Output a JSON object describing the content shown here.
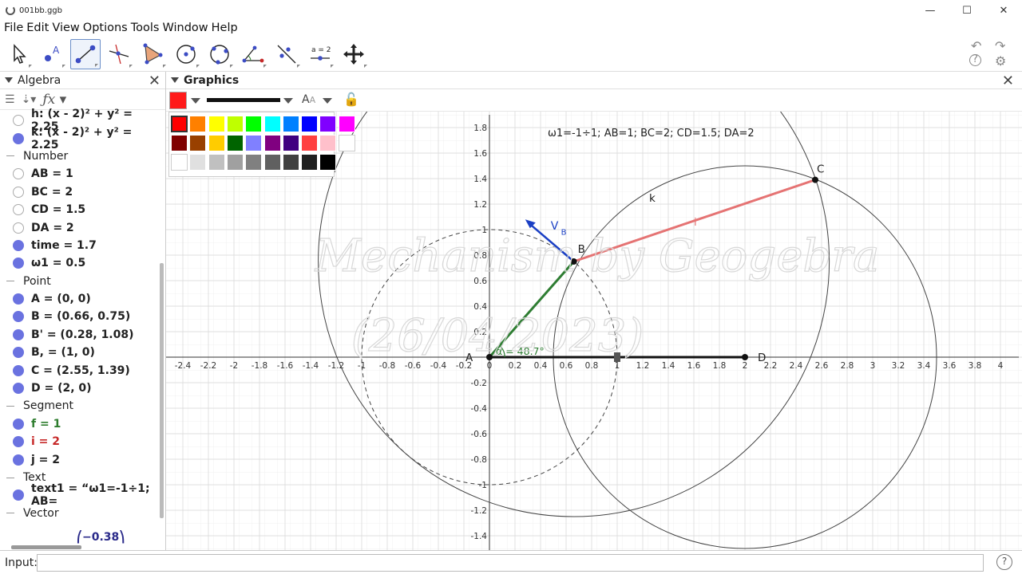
{
  "window": {
    "title": "001bb.ggb",
    "minimize": "—",
    "maximize": "☐",
    "close": "✕"
  },
  "menu": [
    "File",
    "Edit",
    "View",
    "Options",
    "Tools",
    "Window",
    "Help"
  ],
  "toolbar": {
    "tools": [
      "move-tool",
      "point-tool",
      "segment-tool",
      "perpendicular-line-tool",
      "polygon-tool",
      "circle-center-point-tool",
      "circle-three-points-tool",
      "angle-tool",
      "reflect-tool",
      "slider-tool",
      "move-graphics-view-tool"
    ],
    "slider_tool_label": "a = 2",
    "point_tool_label": "A"
  },
  "algebra": {
    "title": "Algebra",
    "items": [
      {
        "type": "item",
        "text": "h: (x - 2)² + y² = 2.25",
        "visible": false,
        "color": "#222222"
      },
      {
        "type": "item",
        "text": "k: (x - 2)² + y² = 2.25",
        "visible": true,
        "color": "#222222"
      },
      {
        "type": "group",
        "text": "Number"
      },
      {
        "type": "item",
        "text": "AB = 1",
        "visible": false,
        "color": "#222222"
      },
      {
        "type": "item",
        "text": "BC = 2",
        "visible": false,
        "color": "#222222"
      },
      {
        "type": "item",
        "text": "CD = 1.5",
        "visible": false,
        "color": "#222222"
      },
      {
        "type": "item",
        "text": "DA = 2",
        "visible": false,
        "color": "#222222"
      },
      {
        "type": "item",
        "text": "time = 1.7",
        "visible": true,
        "color": "#222222"
      },
      {
        "type": "item",
        "text": "ω1 = 0.5",
        "visible": true,
        "color": "#222222"
      },
      {
        "type": "group",
        "text": "Point"
      },
      {
        "type": "item",
        "text": "A = (0, 0)",
        "visible": true,
        "color": "#222222"
      },
      {
        "type": "item",
        "text": "B = (0.66, 0.75)",
        "visible": true,
        "color": "#222222"
      },
      {
        "type": "item",
        "text": "B' = (0.28, 1.08)",
        "visible": true,
        "color": "#222222"
      },
      {
        "type": "item",
        "text": "B, = (1, 0)",
        "visible": true,
        "color": "#222222"
      },
      {
        "type": "item",
        "text": "C = (2.55, 1.39)",
        "visible": true,
        "color": "#222222"
      },
      {
        "type": "item",
        "text": "D = (2, 0)",
        "visible": true,
        "color": "#222222"
      },
      {
        "type": "group",
        "text": "Segment"
      },
      {
        "type": "item",
        "text": "f = 1",
        "visible": true,
        "color": "#2e7d2e"
      },
      {
        "type": "item",
        "text": "i = 2",
        "visible": true,
        "color": "#c62828"
      },
      {
        "type": "item",
        "text": "j = 2",
        "visible": true,
        "color": "#222222"
      },
      {
        "type": "group",
        "text": "Text"
      },
      {
        "type": "item",
        "text": "text1 = “ω1=-1÷1; AB=",
        "visible": true,
        "color": "#222222"
      },
      {
        "type": "group",
        "text": "Vector"
      }
    ],
    "vector_preview": "⎛−0.38⎞"
  },
  "graphics": {
    "title": "Graphics",
    "text1": "ω1=-1÷1; AB=1; BC=2; CD=1.5; DA=2",
    "watermark_line1": "Mechanism by Geogebra",
    "watermark_line2": "(26/04/2023)",
    "angle_label": "α = 48.7°",
    "velocity_label": "V",
    "velocity_sub": "B",
    "labels": {
      "A": "A",
      "B": "B",
      "C": "C",
      "D": "D",
      "k": "k",
      "i": "i"
    },
    "x_ticks": [
      "-2.4",
      "-2.2",
      "-2",
      "-1.8",
      "-1.6",
      "-1.4",
      "-1.2",
      "-1",
      "-0.8",
      "-0.6",
      "-0.4",
      "-0.2",
      "0",
      "0.2",
      "0.4",
      "0.6",
      "0.8",
      "1",
      "1.2",
      "1.4",
      "1.6",
      "1.8",
      "2",
      "2.2",
      "2.4",
      "2.6",
      "2.8",
      "3",
      "3.2",
      "3.4",
      "3.6",
      "3.8",
      "4"
    ],
    "y_ticks": [
      "1.8",
      "1.6",
      "1.4",
      "1.2",
      "1",
      "0.8",
      "0.6",
      "0.4",
      "0.2",
      "-0.2",
      "-0.4",
      "-0.6",
      "-0.8",
      "-1",
      "-1.2",
      "-1.4"
    ],
    "points": {
      "A": [
        0,
        0
      ],
      "B": [
        0.66,
        0.75
      ],
      "C": [
        2.55,
        1.39
      ],
      "D": [
        2,
        0
      ],
      "Bv": [
        0.28,
        1.08
      ]
    },
    "colors": {
      "f": "#2e7d32",
      "i": "#e57373",
      "j": "#111111",
      "vector": "#1a3fc4",
      "point": "#111111"
    }
  },
  "palette": {
    "row1": [
      "#ff0000",
      "#ff8000",
      "#ffff00",
      "#bfff00",
      "#00ff00",
      "#00ffff",
      "#0080ff",
      "#0000ff",
      "#8000ff",
      "#ff00ff"
    ],
    "row2": [
      "#800000",
      "#994000",
      "#ffcc00",
      "#006400",
      "#8080ff",
      "#800080",
      "#400080",
      "#ff4040",
      "#ffc0cb",
      "#ffffff"
    ],
    "row3": [
      "#ffffff",
      "#e0e0e0",
      "#c0c0c0",
      "#a0a0a0",
      "#808080",
      "#606060",
      "#404040",
      "#202020",
      "#000000"
    ]
  },
  "input": {
    "label": "Input:",
    "help": "?"
  }
}
